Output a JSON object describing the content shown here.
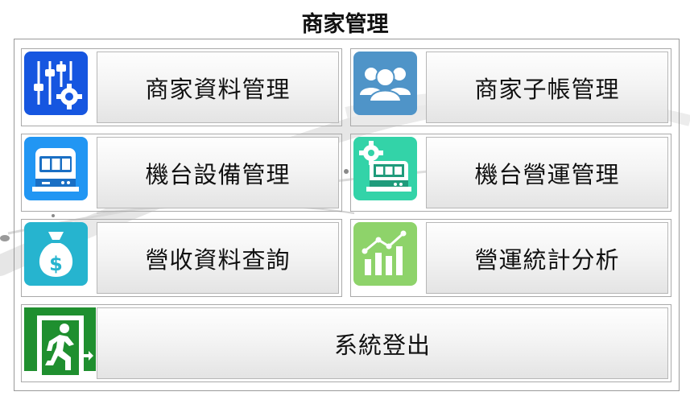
{
  "page": {
    "title": "商家管理"
  },
  "menu": {
    "items": [
      {
        "label": "商家資料管理",
        "icon": "settings-sliders-icon",
        "color": "#1656e0"
      },
      {
        "label": "商家子帳管理",
        "icon": "users-group-icon",
        "color": "#4f94c8"
      },
      {
        "label": "機台設備管理",
        "icon": "slot-machine-icon",
        "color": "#2196f3"
      },
      {
        "label": "機台營運管理",
        "icon": "slot-machine-gear-icon",
        "color": "#33d3a8"
      },
      {
        "label": "營收資料查詢",
        "icon": "money-bag-icon",
        "color": "#26b4cf"
      },
      {
        "label": "營運統計分析",
        "icon": "bar-chart-growth-icon",
        "color": "#8ed36a"
      }
    ],
    "logout": {
      "label": "系統登出",
      "icon": "emergency-exit-icon",
      "color": "#1f8f2f"
    }
  }
}
